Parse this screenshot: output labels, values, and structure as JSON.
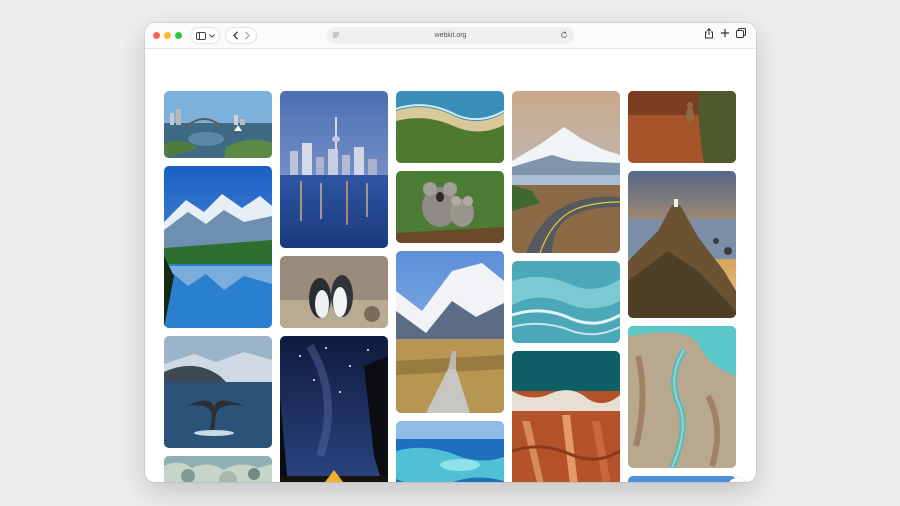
{
  "browser": {
    "url": "webkit.org",
    "traffic_light_colors": {
      "close": "#fe5f57",
      "minimize": "#febc2e",
      "zoom": "#28c840"
    },
    "toolbar_icons": [
      "sidebar-icon",
      "chevron-down-icon",
      "back-icon",
      "forward-icon",
      "reader-icon",
      "reload-icon",
      "share-icon",
      "new-tab-icon",
      "tab-overview-icon"
    ]
  },
  "gallery": {
    "photos": [
      {
        "subject": "sydney-harbour-photo"
      },
      {
        "subject": "mountain-lake-photo"
      },
      {
        "subject": "whale-tail-photo"
      },
      {
        "subject": "coral-photo"
      },
      {
        "subject": "auckland-skyline-photo"
      },
      {
        "subject": "penguins-photo"
      },
      {
        "subject": "night-sky-camping-photo"
      },
      {
        "subject": "coastline-aerial-photo"
      },
      {
        "subject": "koalas-photo"
      },
      {
        "subject": "mountain-boardwalk-photo"
      },
      {
        "subject": "reef-aerial-photo"
      },
      {
        "subject": "mount-cook-road-photo"
      },
      {
        "subject": "ocean-wave-photo"
      },
      {
        "subject": "red-desert-coast-photo"
      },
      {
        "subject": "kangaroo-photo"
      },
      {
        "subject": "lighthouse-cliff-photo"
      },
      {
        "subject": "river-delta-aerial-photo"
      },
      {
        "subject": "blue-sky-photo"
      }
    ]
  },
  "settings_button": {
    "icon": "gear-icon"
  }
}
